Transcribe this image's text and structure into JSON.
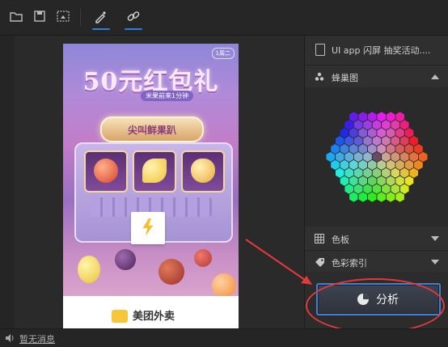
{
  "toolbar": {
    "buttons": [
      {
        "name": "folder-icon"
      },
      {
        "name": "save-icon"
      },
      {
        "name": "crop-select-icon"
      },
      {
        "name": "eyedropper-icon",
        "active": true
      },
      {
        "name": "link-icon",
        "active": true
      }
    ],
    "accent_color": "#2f7fe0"
  },
  "canvas": {
    "poster": {
      "badge": "1周二",
      "title": "50元红包礼",
      "subtitle": "米果前来1分钟",
      "sign_text": "尖叫鲜果趴",
      "footer_text": "美团外卖"
    }
  },
  "right_panel": {
    "file_name": "UI app 闪屏 抽奖活动....",
    "sections": {
      "honeycomb": {
        "label": "蜂巢图",
        "expanded": true,
        "icon": "dots-icon"
      },
      "palette": {
        "label": "色板",
        "expanded": false,
        "icon": "grid-icon"
      },
      "color_index": {
        "label": "色彩索引",
        "expanded": false,
        "icon": "tag-icon"
      }
    },
    "analyze_button": {
      "label": "分析",
      "icon": "pie-chart-icon"
    },
    "highlight_color": "#e23a3a"
  },
  "statusbar": {
    "message": "暂无消息"
  }
}
